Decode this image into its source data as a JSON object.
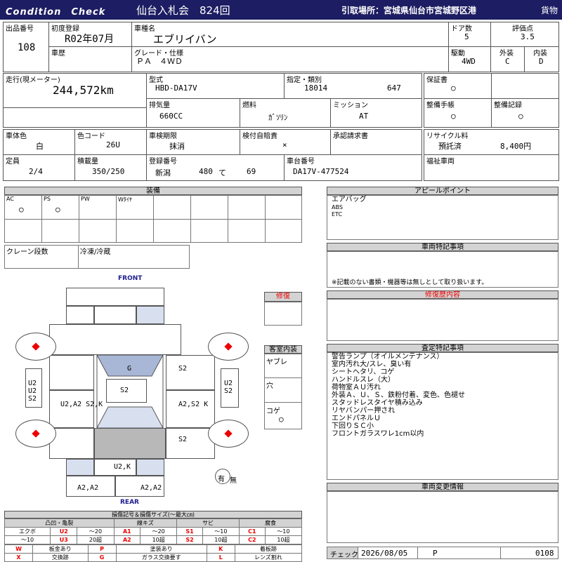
{
  "header": {
    "condition_check": "Condition　Check",
    "title": "仙台入札会　824回",
    "location": "引取場所：宮城県仙台市宮城野区港",
    "cargo": "貨物"
  },
  "row1": {
    "lot_label": "出品番号",
    "lot": "108",
    "reg_label": "初度登録",
    "reg": "R02年07月",
    "name_label": "車種名",
    "name": "エブリイバン",
    "door_label": "ドア数",
    "door": "5",
    "eval_label": "評価点",
    "eval": "3.5"
  },
  "row2": {
    "history_label": "車歴",
    "grade_label": "グレード・仕様",
    "grade": "ＰＡ　４ＷＤ",
    "drive_label": "駆動",
    "drive": "4WD",
    "ext_label": "外装",
    "ext": "C",
    "int_label": "内装",
    "int": "D"
  },
  "row3": {
    "mileage_label": "走行(現メーター)",
    "mileage": "244,572km",
    "model_label": "型式",
    "model": "HBD-DA17V",
    "spec_label": "指定・類別",
    "spec1": "18014",
    "spec2": "647",
    "warranty_label": "保証書",
    "warranty": "○",
    "cc_label": "排気量",
    "cc": "660CC",
    "fuel_label": "燃料",
    "fuel": "ｶﾞｿﾘﾝ",
    "mission_label": "ミッション",
    "mission": "AT",
    "manual_label": "整備手帳",
    "manual": "○",
    "record_label": "整備記録",
    "record": "○"
  },
  "row4": {
    "color_label": "車体色",
    "color": "白",
    "colorcode_label": "色コード",
    "colorcode": "26U",
    "inspect_label": "車検期限",
    "inspect": "抹消",
    "tax_label": "検付自賠責",
    "tax": "×",
    "approval_label": "承認請求書",
    "recycle_label": "リサイクル料",
    "recycle_status": "預託済",
    "recycle_fee": "8,400円"
  },
  "row5": {
    "capacity_label": "定員",
    "capacity": "2/4",
    "load_label": "積載量",
    "load": "350/250",
    "plate_label": "登録番号",
    "plate_area": "新潟",
    "plate_num": "480",
    "plate_kana": "て",
    "plate_no": "69",
    "chassis_label": "車台番号",
    "chassis": "DA17V-477524",
    "welfare_label": "福祉車両"
  },
  "equip": {
    "title": "装備",
    "items": [
      "AC",
      "PS",
      "PW",
      "Wﾀｲﾔ"
    ],
    "ac": "○",
    "ps": "○",
    "crane": "クレーン段数",
    "fridge": "冷凍/冷蔵"
  },
  "appeal": {
    "title": "アピールポイント",
    "lines": [
      "エアバッグ",
      "ABS",
      "ETC"
    ]
  },
  "special": {
    "title": "車両特記事項",
    "note": "※記載のない書類・機器等は無しとして取り扱います。"
  },
  "repair": {
    "title": "修復歴内容"
  },
  "inspection": {
    "title": "査定特記事項",
    "lines": [
      "警告ランプ（オイルメンテナンス）",
      "室内汚れ大/スレ、臭い有",
      "シートヘタリ、コゲ",
      "ハンドルスレ（大）",
      "荷物室ＡＵ汚れ",
      "外装Ａ、Ｕ、Ｓ、鉄粉付着、変色、色褪せ",
      "スタッドレスタイヤ積み込み",
      "リヤバンパー押され",
      "エンドパネルＵ",
      "下回りＳＣ小",
      "フロントガラスワレ1cm以内"
    ]
  },
  "change": {
    "title": "車両変更情報"
  },
  "check": {
    "label": "チェック",
    "date": "2026/08/05",
    "p": "P",
    "no": "0108"
  },
  "diagram": {
    "front": "FRONT",
    "rear": "REAR",
    "repair_label": "修復",
    "cabin_label": "客室内装",
    "yabure": "ヤブレ",
    "ana": "穴",
    "koge": "コゲ",
    "koge_mark": "○",
    "u": "有",
    "mu": "無",
    "marks": {
      "hood": "G",
      "cabin": "S2",
      "left_side": "U2\nU2\nS2",
      "right_side": "U2\nS2",
      "right_front": "S2",
      "left_door": "U2,A2\nS2,K",
      "right_door": "A2,S2\nK",
      "right_rear": "S2",
      "rear": "U2,K",
      "bl": "A2,A2",
      "br": "A2,A2"
    }
  },
  "legend": {
    "title": "損傷記号＆損傷サイズ(〜最大㎝)",
    "groups": [
      "凸凹・亀裂",
      "線キズ",
      "サビ",
      "腐食"
    ],
    "r1": [
      "エクボ",
      "U2",
      "〜20",
      "A1",
      "〜20",
      "S1",
      "〜10",
      "C1",
      "〜10"
    ],
    "r2": [
      "〜10",
      "U3",
      "20超",
      "A2",
      "10超",
      "S2",
      "10超",
      "C2",
      "10超"
    ],
    "r3": [
      "W",
      "板金あり",
      "P",
      "塗装あり",
      "K",
      "着板跡"
    ],
    "r4": [
      "X",
      "交換跡",
      "G",
      "ガラス交換要す",
      "L",
      "レンズ割れ"
    ]
  }
}
